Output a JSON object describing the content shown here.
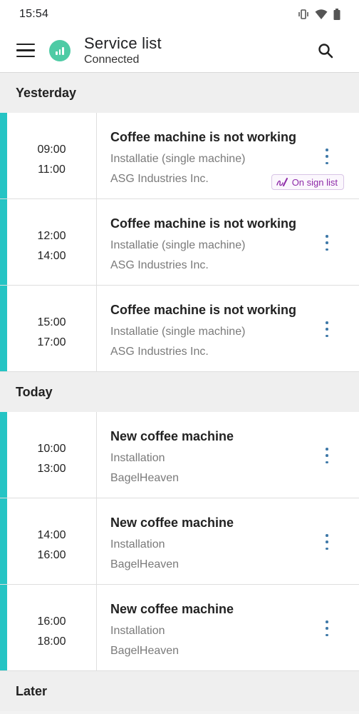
{
  "status_bar": {
    "time": "15:54",
    "icons": [
      "vibrate-icon",
      "wifi-icon",
      "battery-icon"
    ]
  },
  "app_bar": {
    "title": "Service list",
    "subtitle": "Connected",
    "menu_icon": "hamburger-menu-icon",
    "search_icon": "search-icon"
  },
  "colors": {
    "accent": "#25c4c4",
    "connected_badge": "#4ecba5",
    "more_icon": "#3f79a8",
    "sign_badge_text": "#8e2aa8"
  },
  "sections": [
    {
      "header": "Yesterday",
      "items": [
        {
          "start": "09:00",
          "end": "11:00",
          "title": "Coffee machine is not working",
          "type": "Installatie (single machine)",
          "customer": "ASG Industries Inc.",
          "badge": "On sign list"
        },
        {
          "start": "12:00",
          "end": "14:00",
          "title": "Coffee machine is not working",
          "type": "Installatie (single machine)",
          "customer": "ASG Industries Inc."
        },
        {
          "start": "15:00",
          "end": "17:00",
          "title": "Coffee machine is not working",
          "type": "Installatie (single machine)",
          "customer": "ASG Industries Inc."
        }
      ]
    },
    {
      "header": "Today",
      "items": [
        {
          "start": "10:00",
          "end": "13:00",
          "title": "New coffee machine",
          "type": "Installation",
          "customer": "BagelHeaven"
        },
        {
          "start": "14:00",
          "end": "16:00",
          "title": "New coffee machine",
          "type": "Installation",
          "customer": "BagelHeaven"
        },
        {
          "start": "16:00",
          "end": "18:00",
          "title": "New coffee machine",
          "type": "Installation",
          "customer": "BagelHeaven"
        }
      ]
    },
    {
      "header": "Later",
      "items": []
    }
  ]
}
